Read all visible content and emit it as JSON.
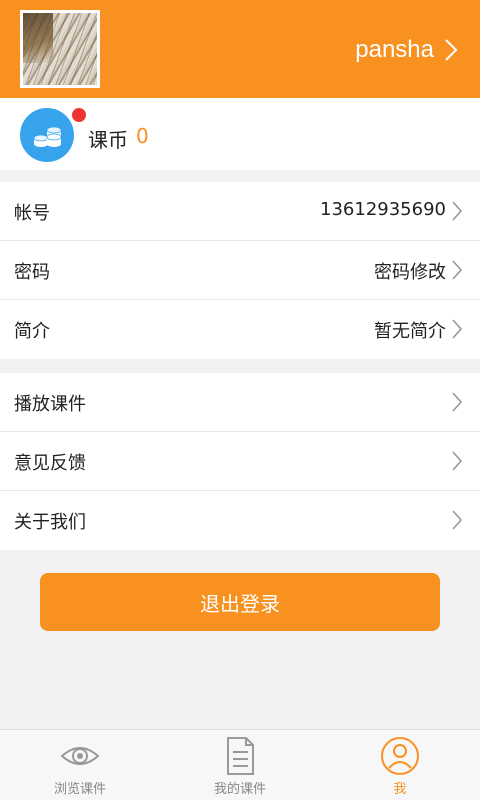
{
  "header": {
    "username": "pansha"
  },
  "coins": {
    "label": "课币",
    "value": "0"
  },
  "account_group": [
    {
      "label": "帐号",
      "value": "13612935690"
    },
    {
      "label": "密码",
      "value": "密码修改"
    },
    {
      "label": "简介",
      "value": "暂无简介"
    }
  ],
  "misc_group": [
    {
      "label": "播放课件"
    },
    {
      "label": "意见反馈"
    },
    {
      "label": "关于我们"
    }
  ],
  "logout_label": "退出登录",
  "tabs": [
    {
      "label": "浏览课件",
      "icon": "eye-icon",
      "active": false
    },
    {
      "label": "我的课件",
      "icon": "document-icon",
      "active": false
    },
    {
      "label": "我",
      "icon": "user-icon",
      "active": true
    }
  ],
  "colors": {
    "accent": "#f8911f",
    "coin_icon": "#37a3ec",
    "badge": "#ee3333",
    "background": "#f2f2f2"
  }
}
